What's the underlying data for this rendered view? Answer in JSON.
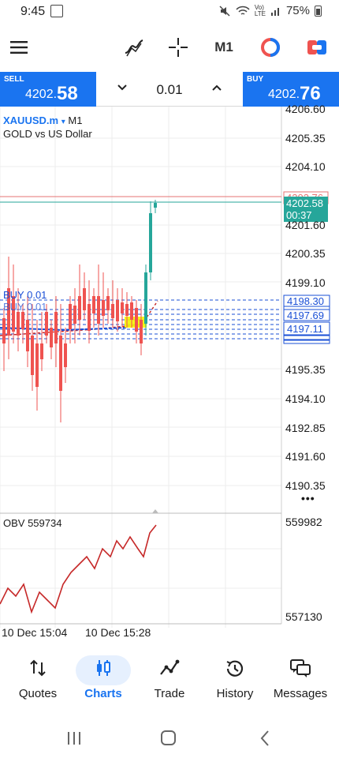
{
  "status_bar": {
    "time": "9:45",
    "battery": "75%"
  },
  "toolbar": {
    "timeframe": "M1"
  },
  "trade": {
    "sell_label": "SELL",
    "sell_price_main": "4202.",
    "sell_price_big": "58",
    "volume": "0.01",
    "buy_label": "BUY",
    "buy_price_main": "4202.",
    "buy_price_big": "76"
  },
  "chart": {
    "symbol": "XAUUSD.m",
    "symbol_marker": "▾",
    "timeframe": "M1",
    "description": "GOLD vs US Dollar",
    "price_ticks": [
      "4206.60",
      "4205.35",
      "4204.10",
      "4201.60",
      "4200.35",
      "4199.10",
      "4195.35",
      "4194.10",
      "4192.85",
      "4191.60",
      "4190.35"
    ],
    "ask_tag": "4202.76",
    "bid_tag": "4202.58",
    "bid_countdown": "00:37",
    "order_tags": [
      "4198.30",
      "4197.69",
      "4197.11"
    ],
    "order_labels": [
      "BUY 0.01",
      "BUY 0.01"
    ],
    "obv_label": "OBV 559734",
    "obv_ticks": [
      "559982",
      "557130"
    ],
    "time_labels": [
      "10 Dec 15:04",
      "10 Dec 15:28"
    ],
    "more_menu": "•••",
    "colors": {
      "bull": "#26a69a",
      "bear": "#ef5350",
      "order": "#1a4fd6",
      "obv_line": "#c62828",
      "ask_line": "#e57373"
    }
  },
  "nav": {
    "items": [
      {
        "label": "Quotes",
        "icon": "quotes-icon"
      },
      {
        "label": "Charts",
        "icon": "charts-icon"
      },
      {
        "label": "Trade",
        "icon": "trade-icon"
      },
      {
        "label": "History",
        "icon": "history-icon"
      },
      {
        "label": "Messages",
        "icon": "messages-icon"
      }
    ],
    "active": "Charts"
  }
}
